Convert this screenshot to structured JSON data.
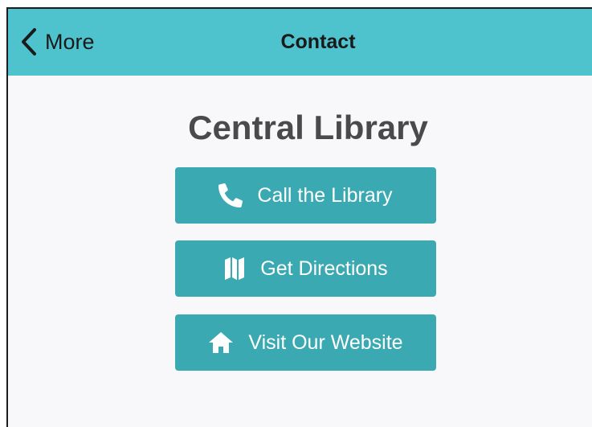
{
  "navbar": {
    "back_label": "More",
    "title": "Contact",
    "background_color": "#4fc3cd"
  },
  "library": {
    "name": "Central Library"
  },
  "actions": [
    {
      "label": "Call the Library",
      "icon": "phone-icon"
    },
    {
      "label": "Get Directions",
      "icon": "map-icon"
    },
    {
      "label": "Visit Our Website",
      "icon": "home-icon"
    }
  ],
  "colors": {
    "button": "#3aa9b1",
    "title_text": "#4a4a4a",
    "page_background": "#f8f7f9"
  }
}
